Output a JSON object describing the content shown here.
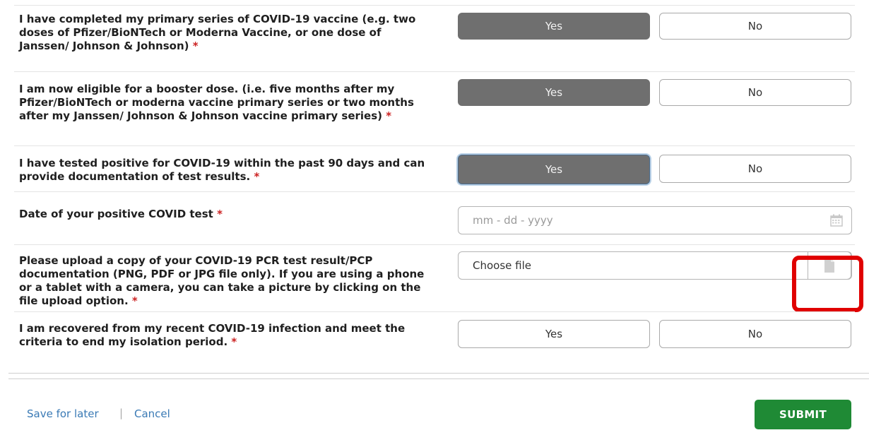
{
  "questions": [
    {
      "text": "I have completed my primary series of COVID-19 vaccine (e.g. two doses of Pfizer/BioNTech or Moderna Vaccine, or one dose of Janssen/ Johnson & Johnson)",
      "yes": "Yes",
      "no": "No",
      "selected": "yes"
    },
    {
      "text": "I am now eligible for a booster dose. (i.e. five months after my Pfizer/BioNTech or moderna vaccine primary series or two months after my Janssen/ Johnson & Johnson vaccine primary series)",
      "yes": "Yes",
      "no": "No",
      "selected": "yes"
    },
    {
      "text": "I have tested positive for COVID-19 within the past 90 days and can provide documentation of test results.",
      "yes": "Yes",
      "no": "No",
      "selected": "yes"
    },
    {
      "text": "Date of your positive COVID test",
      "placeholder": "mm - dd - yyyy",
      "icon": "calendar-icon"
    },
    {
      "text": "Please upload a copy of your COVID-19 PCR test result/PCP documentation (PNG, PDF or JPG file only). If you are using a phone or a tablet with a camera, you can take a picture by clicking on the file upload option.",
      "choose_label": "Choose file",
      "icon": "file-icon"
    },
    {
      "text": "I am recovered from my recent COVID-19 infection and meet the criteria to end my isolation period.",
      "yes": "Yes",
      "no": "No",
      "selected": ""
    }
  ],
  "required_marker": "*",
  "footer": {
    "save_label": "Save for later",
    "separator": "|",
    "cancel_label": "Cancel",
    "submit_label": "SUBMIT"
  },
  "colors": {
    "selected_button": "#6f6f6f",
    "submit": "#1f8a35",
    "link": "#3a7ab5",
    "required": "#cc2222",
    "highlight": "#e00000"
  }
}
